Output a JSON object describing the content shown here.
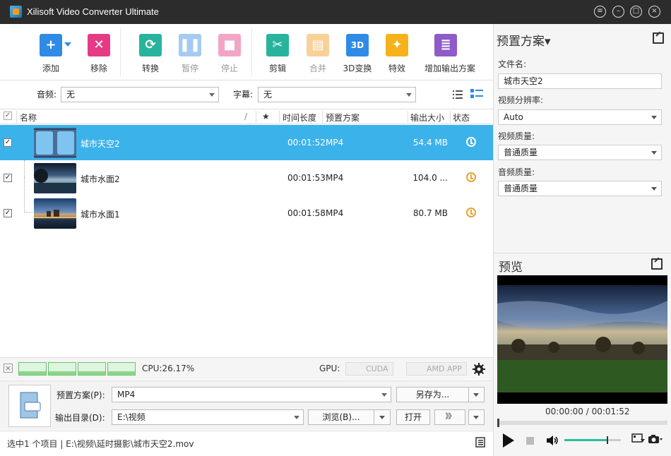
{
  "app": {
    "title": "Xilisoft Video Converter Ultimate"
  },
  "toolbar": {
    "add": "添加",
    "remove": "移除",
    "convert": "转换",
    "pause": "暂停",
    "stop": "停止",
    "clip": "剪辑",
    "merge": "合并",
    "threed": "3D变换",
    "effects": "特效",
    "add_profile": "增加输出方案",
    "threed_badge": "3D"
  },
  "filters": {
    "audio_label": "音频:",
    "audio_value": "无",
    "subtitle_label": "字幕:",
    "subtitle_value": "无"
  },
  "columns": {
    "name": "名称",
    "star": "★",
    "duration": "时间长度",
    "profile": "预置方案",
    "size": "输出大小",
    "status": "状态",
    "sep": "/"
  },
  "files": [
    {
      "name": "城市天空2",
      "duration": "00:01:52",
      "profile": "MP4",
      "size": "54.4 MB",
      "check": "✓"
    },
    {
      "name": "城市水面2",
      "duration": "00:01:53",
      "profile": "MP4",
      "size": "104.0 ...",
      "check": "✓"
    },
    {
      "name": "城市水面1",
      "duration": "00:01:58",
      "profile": "MP4",
      "size": "80.7 MB",
      "check": "✓"
    }
  ],
  "cpu": {
    "text": "CPU:26.17%",
    "gpu_label": "GPU:",
    "cuda": "CUDA",
    "amdapp": "AMD APP",
    "close": "×"
  },
  "output": {
    "profile_label": "预置方案(P):",
    "profile_value": "MP4",
    "save_as": "另存为...",
    "dir_label": "输出目录(D):",
    "dir_value": "E:\\视频",
    "browse": "浏览(B)...",
    "open": "打开",
    "forward": "》》"
  },
  "status": {
    "text": "选中1 个项目 | E:\\视频\\延时摄影\\城市天空2.mov"
  },
  "preset": {
    "title": "预置方案▾",
    "filename_label": "文件名:",
    "filename_value": "城市天空2",
    "resolution_label": "视频分辨率:",
    "resolution_value": "Auto",
    "vquality_label": "视频质量:",
    "vquality_value": "普通质量",
    "aquality_label": "音频质量:",
    "aquality_value": "普通质量"
  },
  "preview": {
    "title": "预览",
    "time": "00:00:00 / 00:01:52",
    "volume": 0.75,
    "progress": 0.0
  }
}
